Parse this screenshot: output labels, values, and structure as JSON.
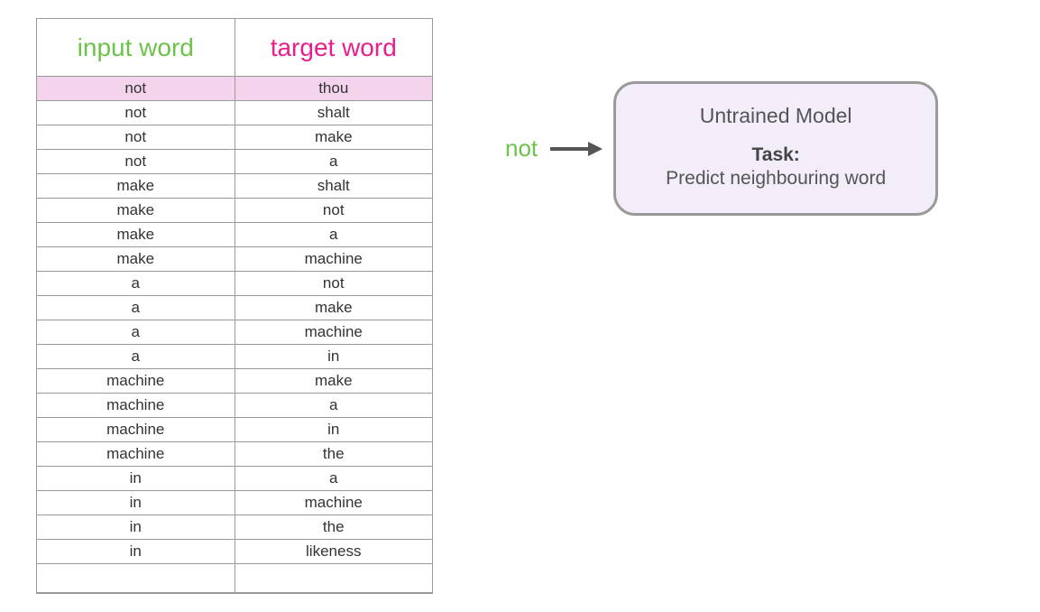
{
  "table": {
    "headers": {
      "input": "input word",
      "target": "target word"
    },
    "rows": [
      {
        "input": "not",
        "target": "thou",
        "highlight": true
      },
      {
        "input": "not",
        "target": "shalt"
      },
      {
        "input": "not",
        "target": "make"
      },
      {
        "input": "not",
        "target": "a"
      },
      {
        "input": "make",
        "target": "shalt"
      },
      {
        "input": "make",
        "target": "not"
      },
      {
        "input": "make",
        "target": "a"
      },
      {
        "input": "make",
        "target": "machine"
      },
      {
        "input": "a",
        "target": "not"
      },
      {
        "input": "a",
        "target": "make"
      },
      {
        "input": "a",
        "target": "machine"
      },
      {
        "input": "a",
        "target": "in"
      },
      {
        "input": "machine",
        "target": "make"
      },
      {
        "input": "machine",
        "target": "a"
      },
      {
        "input": "machine",
        "target": "in"
      },
      {
        "input": "machine",
        "target": "the"
      },
      {
        "input": "in",
        "target": "a"
      },
      {
        "input": "in",
        "target": "machine"
      },
      {
        "input": "in",
        "target": "the"
      },
      {
        "input": "in",
        "target": "likeness"
      }
    ]
  },
  "flow": {
    "input_token": "not"
  },
  "model": {
    "title": "Untrained Model",
    "task_label": "Task:",
    "task_desc": "Predict neighbouring word"
  },
  "colors": {
    "input_accent": "#6cc24a",
    "target_accent": "#e91e8c",
    "highlight_bg": "#f4d3ec",
    "model_bg": "#f3ecf9",
    "model_border": "#9a9a9a"
  }
}
